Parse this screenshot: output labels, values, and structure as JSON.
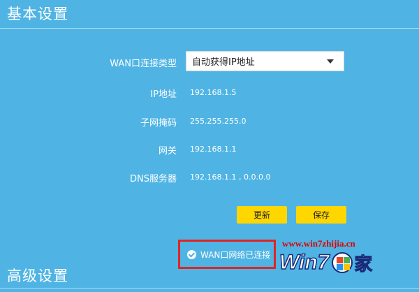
{
  "sections": {
    "basic_title": "基本设置",
    "advanced_title": "高级设置"
  },
  "wan": {
    "type_label": "WAN口连接类型",
    "type_selected": "自动获得IP地址"
  },
  "fields": {
    "ip": {
      "label": "IP地址",
      "value": "192.168.1.5"
    },
    "mask": {
      "label": "子网掩码",
      "value": "255.255.255.0"
    },
    "gateway": {
      "label": "网关",
      "value": "192.168.1.1"
    },
    "dns": {
      "label": "DNS服务器",
      "value": "192.168.1.1 , 0.0.0.0"
    }
  },
  "buttons": {
    "update": "更新",
    "save": "保存"
  },
  "status": {
    "text": "WAN口网络已连接"
  },
  "watermark": {
    "url": "www.win7zhijia.cn",
    "brand_text": "Win7",
    "brand_suffix": "家"
  },
  "colors": {
    "background": "#4fb4e4",
    "button": "#ffd700",
    "highlight_box": "#e02424",
    "watermark_url": "#e00000"
  },
  "icons": {
    "select_chevron": "chevron-down-icon",
    "status_check": "check-circle-icon",
    "watermark_flag": "windows-logo-icon"
  }
}
